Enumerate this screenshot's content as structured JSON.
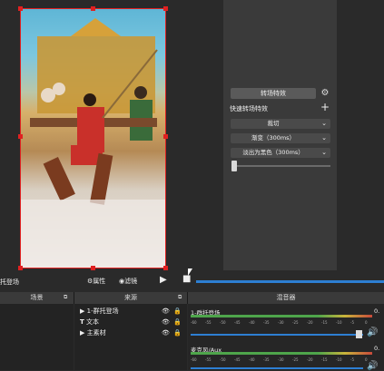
{
  "transitions": {
    "title": "转场特效",
    "quick_label": "快速转场特效",
    "options": [
      "裁切",
      "渐变（300ms）",
      "淡出为黑色（300ms）"
    ]
  },
  "toolbar": {
    "scene_fragment": "托登场",
    "properties_label": "属性",
    "filters_label": "滤镜"
  },
  "docks": {
    "scenes_title": "场景",
    "sources_title": "来源",
    "mixer_title": "混音器"
  },
  "sources": [
    {
      "icon": "play-icon",
      "label": "1-群托登场"
    },
    {
      "icon": "text-icon",
      "label": "文本"
    },
    {
      "icon": "play-icon",
      "label": "主素材"
    }
  ],
  "mixer": {
    "channels": [
      {
        "name": "1-群托登场",
        "value": "0."
      },
      {
        "name": "麦克风/Aux",
        "value": "0."
      }
    ],
    "ticks": [
      "-60",
      "-55",
      "-50",
      "-45",
      "-40",
      "-35",
      "-30",
      "-25",
      "-20",
      "-15",
      "-10",
      "-5",
      "0"
    ]
  },
  "colors": {
    "accent": "#2d7fd3",
    "selection": "#e02020"
  }
}
